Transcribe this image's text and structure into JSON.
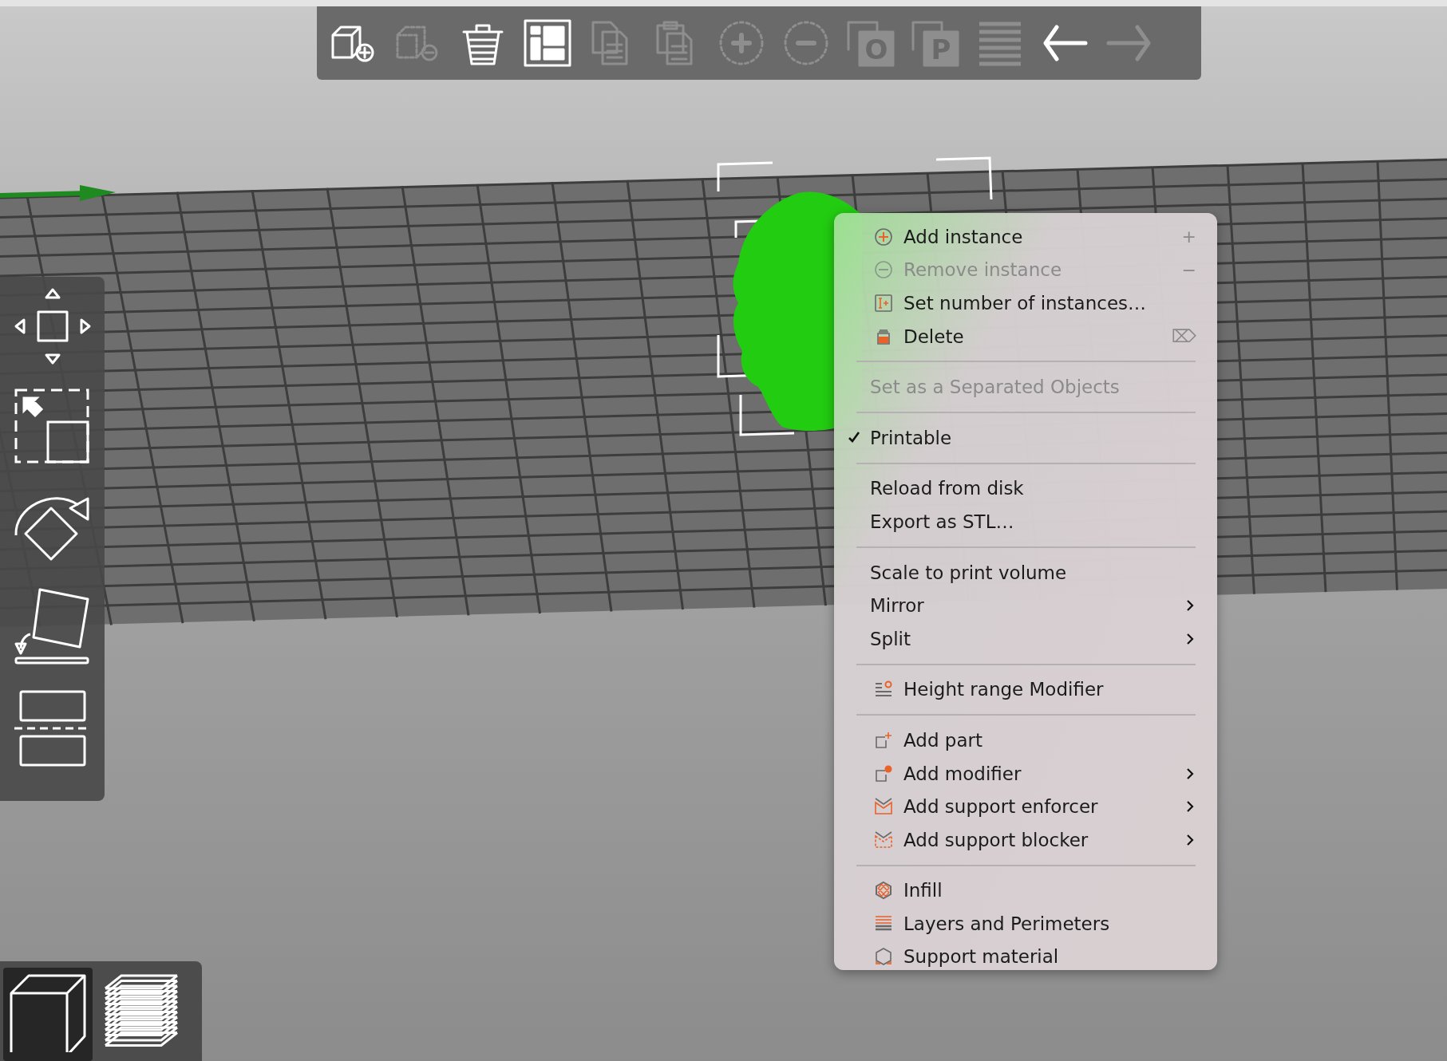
{
  "toolbar": [
    {
      "disabled": false
    },
    {
      "disabled": true
    },
    {
      "disabled": false
    },
    {
      "disabled": false
    },
    {
      "disabled": true
    },
    {
      "disabled": true
    },
    {
      "disabled": true
    },
    {
      "disabled": true
    },
    {
      "label": "O",
      "disabled": true
    },
    {
      "label": "P",
      "disabled": true
    },
    {
      "disabled": true
    },
    {
      "disabled": false
    },
    {
      "disabled": true
    }
  ],
  "view_tabs": [
    {
      "selected": true
    },
    {
      "selected": false
    }
  ],
  "context_menu": {
    "sections": [
      [
        {
          "label": "Add instance",
          "kind": "icon",
          "shortcut": "+",
          "disabled": false,
          "checked": false,
          "submenu": false
        },
        {
          "label": "Remove instance",
          "kind": "icon",
          "shortcut": "−",
          "disabled": true,
          "checked": false,
          "submenu": false
        },
        {
          "label": "Set number of instances…",
          "kind": "icon",
          "disabled": false,
          "checked": false,
          "submenu": false
        },
        {
          "label": "Delete",
          "kind": "icon",
          "shortcut": "⌦",
          "disabled": false,
          "checked": false,
          "submenu": false
        }
      ],
      [
        {
          "label": "Set as a Separated Objects",
          "kind": "plain",
          "disabled": true,
          "checked": false,
          "submenu": false
        }
      ],
      [
        {
          "label": "Printable",
          "kind": "plain",
          "disabled": false,
          "checked": true,
          "submenu": false
        }
      ],
      [
        {
          "label": "Reload from disk",
          "kind": "plain",
          "disabled": false,
          "checked": false,
          "submenu": false
        },
        {
          "label": "Export as STL…",
          "kind": "plain",
          "disabled": false,
          "checked": false,
          "submenu": false
        }
      ],
      [
        {
          "label": "Scale to print volume",
          "kind": "plain",
          "disabled": false,
          "checked": false,
          "submenu": false
        },
        {
          "label": "Mirror",
          "kind": "plain",
          "disabled": false,
          "checked": false,
          "submenu": true
        },
        {
          "label": "Split",
          "kind": "plain",
          "disabled": false,
          "checked": false,
          "submenu": true
        }
      ],
      [
        {
          "label": "Height range Modifier",
          "kind": "icon",
          "disabled": false,
          "checked": false,
          "submenu": false
        }
      ],
      [
        {
          "label": "Add part",
          "kind": "icon",
          "disabled": false,
          "checked": false,
          "submenu": false
        },
        {
          "label": "Add modifier",
          "kind": "icon",
          "disabled": false,
          "checked": false,
          "submenu": true
        },
        {
          "label": "Add support enforcer",
          "kind": "icon",
          "disabled": false,
          "checked": false,
          "submenu": true
        },
        {
          "label": "Add support blocker",
          "kind": "icon",
          "disabled": false,
          "checked": false,
          "submenu": true
        }
      ],
      [
        {
          "label": "Infill",
          "kind": "icon",
          "disabled": false,
          "checked": false,
          "submenu": false
        },
        {
          "label": "Layers and Perimeters",
          "kind": "icon",
          "disabled": false,
          "checked": false,
          "submenu": false
        },
        {
          "label": "Support material",
          "kind": "icon",
          "disabled": false,
          "checked": false,
          "submenu": false
        }
      ]
    ]
  }
}
